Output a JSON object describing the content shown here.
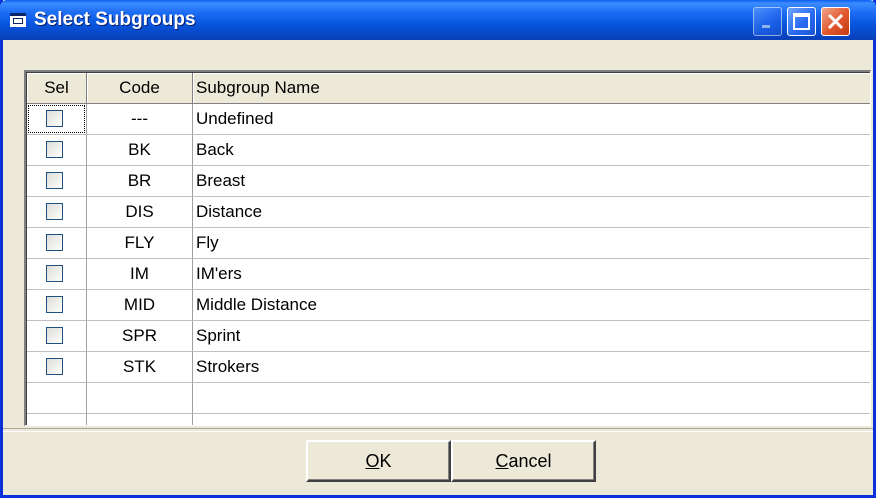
{
  "window": {
    "title": "Select Subgroups"
  },
  "grid": {
    "columns": [
      "Sel",
      "Code",
      "Subgroup Name"
    ],
    "rows": [
      {
        "selected": false,
        "code": "---",
        "name": "Undefined"
      },
      {
        "selected": false,
        "code": "BK",
        "name": "Back"
      },
      {
        "selected": false,
        "code": "BR",
        "name": "Breast"
      },
      {
        "selected": false,
        "code": "DIS",
        "name": "Distance"
      },
      {
        "selected": false,
        "code": "FLY",
        "name": "Fly"
      },
      {
        "selected": false,
        "code": "IM",
        "name": "IM'ers"
      },
      {
        "selected": false,
        "code": "MID",
        "name": "Middle Distance"
      },
      {
        "selected": false,
        "code": "SPR",
        "name": "Sprint"
      },
      {
        "selected": false,
        "code": "STK",
        "name": "Strokers"
      }
    ]
  },
  "buttons": {
    "ok": {
      "mnemonic": "O",
      "rest": "K"
    },
    "cancel": {
      "mnemonic": "C",
      "rest": "ancel"
    }
  }
}
